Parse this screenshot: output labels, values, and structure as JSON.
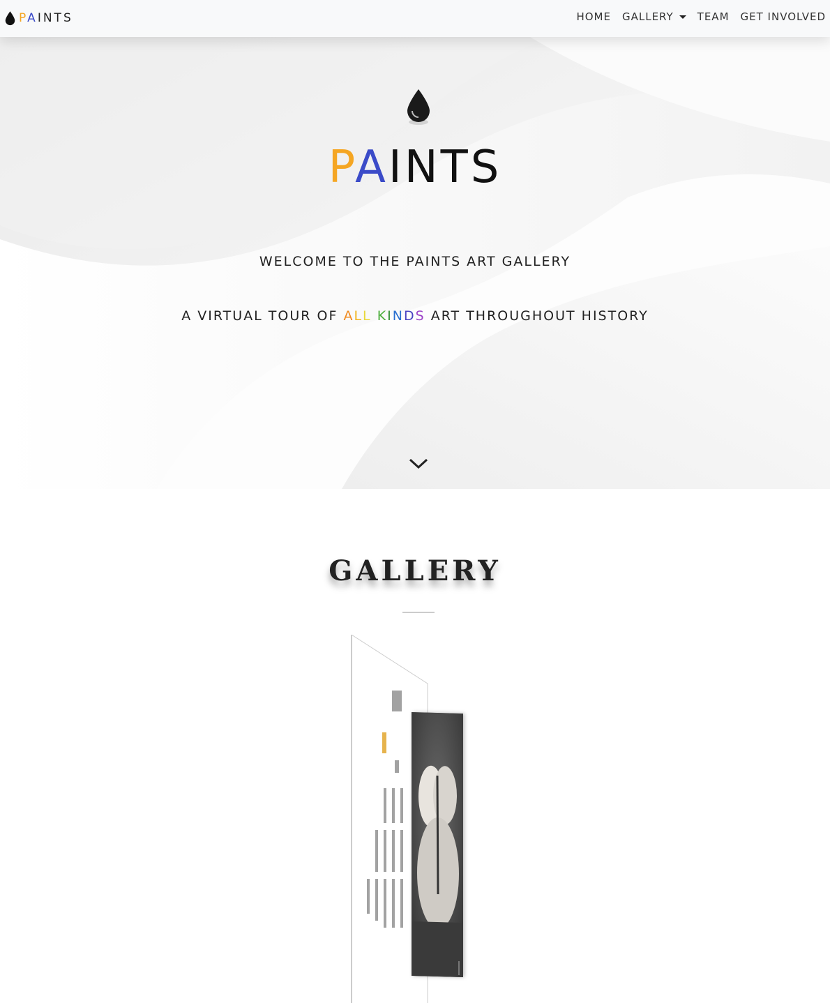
{
  "nav": {
    "brand_letters": [
      {
        "ch": "P",
        "color": "#f5a623"
      },
      {
        "ch": "A",
        "color": "#3b4bc8"
      },
      {
        "ch": "I",
        "color": "#222222"
      },
      {
        "ch": "N",
        "color": "#222222"
      },
      {
        "ch": "T",
        "color": "#222222"
      },
      {
        "ch": "S",
        "color": "#222222"
      }
    ],
    "brand_icon": "drop-icon",
    "links": [
      {
        "label": "HOME"
      },
      {
        "label": "GALLERY",
        "has_dropdown": true
      },
      {
        "label": "TEAM"
      },
      {
        "label": "GET INVOLVED"
      }
    ]
  },
  "hero": {
    "icon": "drop-icon",
    "title": "PAINTS",
    "welcome": "WELCOME TO THE PAINTS ART GALLERY",
    "sub_before": "A VIRTUAL TOUR OF",
    "sub_rainbow": [
      {
        "ch": "A",
        "color": "#f08a1e"
      },
      {
        "ch": "L",
        "color": "#f2b51e"
      },
      {
        "ch": "L",
        "color": "#e8d83a"
      },
      {
        "ch": " ",
        "color": "#222222"
      },
      {
        "ch": "K",
        "color": "#4caf3c"
      },
      {
        "ch": "I",
        "color": "#2f8f2f"
      },
      {
        "ch": "N",
        "color": "#2a6fd0"
      },
      {
        "ch": "D",
        "color": "#4a44c2"
      },
      {
        "ch": "S",
        "color": "#9c44c8"
      }
    ],
    "sub_after": "ART THROUGHOUT HISTORY",
    "scroll_icon": "chevron-down-icon",
    "title_colors": {
      "P": "#f5a623",
      "A": "#3b4bc8"
    }
  },
  "gallery": {
    "title": "GALLERY"
  }
}
